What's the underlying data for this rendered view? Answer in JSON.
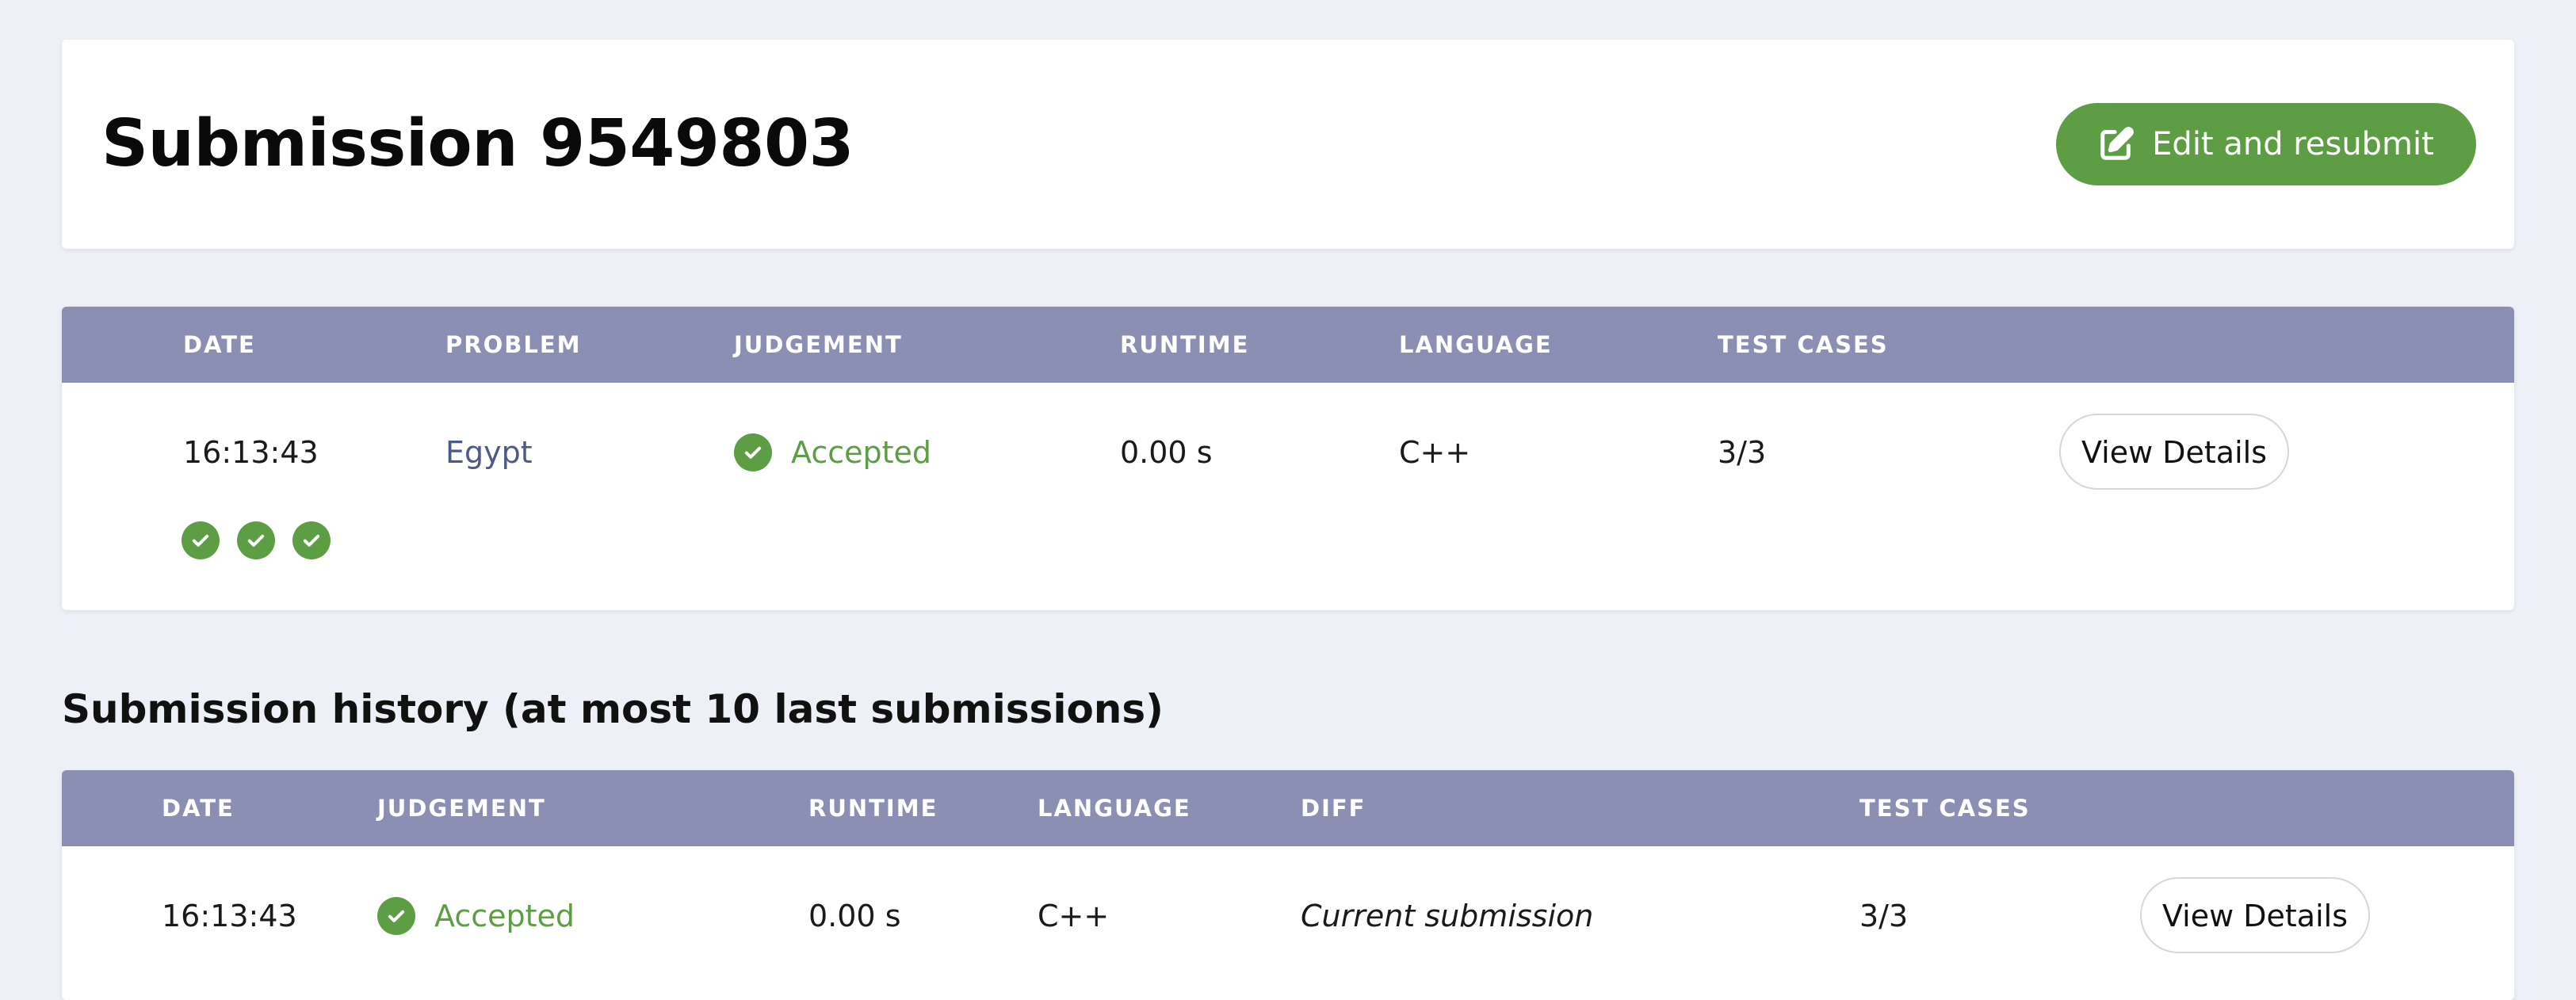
{
  "header": {
    "title": "Submission 9549803",
    "resubmit_label": "Edit and resubmit",
    "resubmit_icon": "edit-icon",
    "accent_color": "#5d9e45"
  },
  "submission": {
    "columns": [
      "DATE",
      "PROBLEM",
      "JUDGEMENT",
      "RUNTIME",
      "LANGUAGE",
      "TEST CASES"
    ],
    "row": {
      "date": "16:13:43",
      "problem": "Egypt",
      "judgement": "Accepted",
      "runtime": "0.00 s",
      "language": "C++",
      "test_cases": "3/3",
      "action": "View Details"
    },
    "test_case_results": [
      "passed",
      "passed",
      "passed"
    ]
  },
  "history": {
    "heading": "Submission history (at most 10 last submissions)",
    "columns": [
      "DATE",
      "JUDGEMENT",
      "RUNTIME",
      "LANGUAGE",
      "DIFF",
      "TEST CASES"
    ],
    "rows": [
      {
        "date": "16:13:43",
        "judgement": "Accepted",
        "runtime": "0.00 s",
        "language": "C++",
        "diff": "Current submission",
        "test_cases": "3/3",
        "action": "View Details"
      }
    ]
  },
  "colors": {
    "table_header_bg": "#8c8fb4",
    "accepted": "#5d9e45",
    "link": "#4e5a86",
    "page_bg": "#eef0f7"
  }
}
